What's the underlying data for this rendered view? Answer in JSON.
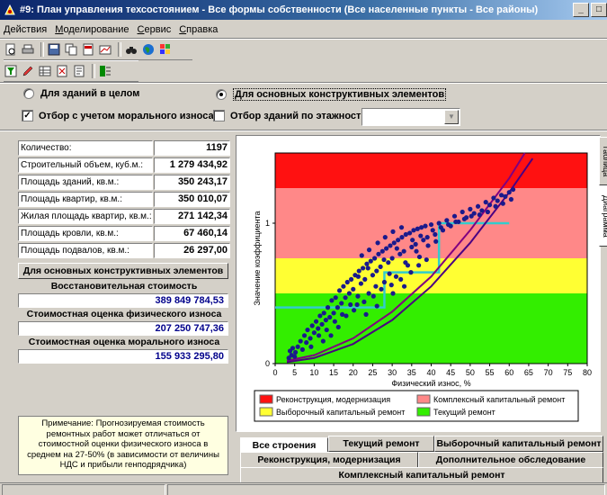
{
  "window": {
    "title": "#9: План управления техсостоянием - Все формы собственности (Все населенные пункты - Все районы)",
    "min_label": "_",
    "max_label": "□"
  },
  "menu": [
    "Действия",
    "Моделирование",
    "Сервис",
    "Справка"
  ],
  "toolbar_icons": {
    "row1": [
      "preview-icon",
      "print-icon",
      "save-icon",
      "copy-icon",
      "pdf-export-icon",
      "chart-export-icon",
      "binoculars-icon",
      "globe-icon",
      "palette-icon"
    ],
    "row2": [
      "filter-icon",
      "edit-icon",
      "table-icon",
      "calc-icon",
      "report-icon",
      "settings-icon"
    ]
  },
  "options": {
    "radio_whole": "Для зданий в целом",
    "radio_elements": "Для основных конструктивных элементов",
    "selected": "radio_elements",
    "chk_moral": "Отбор с учетом морального износа",
    "chk_moral_checked": true,
    "chk_floors": "Отбор зданий по этажности",
    "chk_floors_checked": false,
    "floors_value": ""
  },
  "stats": [
    {
      "label": "Количество:",
      "value": "1197"
    },
    {
      "label": "Строительный объем, куб.м.:",
      "value": "1 279 434,92"
    },
    {
      "label": "Площадь зданий, кв.м.:",
      "value": "350 243,17"
    },
    {
      "label": "Площадь квартир, кв.м.:",
      "value": "350 010,07"
    },
    {
      "label": "Жилая площадь квартир, кв.м.:",
      "value": "271 142,34"
    },
    {
      "label": "Площадь кровли, кв.м.:",
      "value": "67 460,14"
    },
    {
      "label": "Площадь подвалов, кв.м.:",
      "value": "26 297,00"
    }
  ],
  "section_button": "Для основных конструктивных элементов",
  "costs": [
    {
      "label": "Восстановительная стоимость",
      "value": "389 849 784,53"
    },
    {
      "label": "Стоимостная оценка физического износа",
      "value": "207 250 747,36"
    },
    {
      "label": "Стоимостная оценка морального износа",
      "value": "155 933 295,80"
    }
  ],
  "note": "Примечание: Прогнозируемая стоимость ремонтных работ может отличаться от стоимостной оценки физического износа в среднем на 27-50% (в зависимости от величины НДС и прибыли генподрядчика)",
  "side_tabs": [
    "Таблица",
    "Диаграмма"
  ],
  "bottom_tabs": {
    "row1": [
      "Все строения",
      "Текущий ремонт",
      "Выборочный капитальный ремонт"
    ],
    "row2": [
      "Реконструкция, модернизация",
      "Дополнительное обследование"
    ],
    "row3": [
      "Комплексный капитальный ремонт"
    ],
    "selected": "Все строения"
  },
  "chart_data": {
    "type": "scatter",
    "xlabel": "Физический износ, %",
    "ylabel": "Значение коэффициента",
    "xlim": [
      0,
      80
    ],
    "xticks": [
      0,
      5,
      10,
      15,
      20,
      25,
      30,
      35,
      40,
      45,
      50,
      55,
      60,
      65,
      70,
      75,
      80
    ],
    "ylim": [
      0,
      1.5
    ],
    "yticks": [
      {
        "v": 0,
        "label": "0"
      },
      {
        "v": 1,
        "label": "1"
      }
    ],
    "zones": [
      {
        "name": "Текущий ремонт",
        "from": 0,
        "to": 0.5,
        "color": "#33ee00"
      },
      {
        "name": "Выборочный капитальный ремонт",
        "from": 0.5,
        "to": 0.75,
        "color": "#ffff33"
      },
      {
        "name": "Комплексный капитальный ремонт",
        "from": 0.75,
        "to": 1.25,
        "color": "#ff8888"
      },
      {
        "name": "Реконструкция, модернизация",
        "from": 1.25,
        "to": 1.5,
        "color": "#ff1111"
      }
    ],
    "legend": [
      {
        "name": "Реконструкция, модернизация",
        "color": "#ff1111"
      },
      {
        "name": "Комплексный капитальный ремонт",
        "color": "#ff8888"
      },
      {
        "name": "Выборочный капитальный ремонт",
        "color": "#ffff33"
      },
      {
        "name": "Текущий ремонт",
        "color": "#33ee00"
      }
    ],
    "threshold_line": {
      "color": "#33cccc",
      "points": [
        [
          0,
          0.4
        ],
        [
          28,
          0.4
        ],
        [
          28,
          0.65
        ],
        [
          42,
          0.65
        ],
        [
          42,
          1.0
        ],
        [
          60,
          1.0
        ]
      ]
    },
    "curves": [
      {
        "color": "#800080",
        "points": [
          [
            3,
            0.02
          ],
          [
            10,
            0.06
          ],
          [
            20,
            0.18
          ],
          [
            30,
            0.37
          ],
          [
            40,
            0.62
          ],
          [
            50,
            0.95
          ],
          [
            60,
            1.32
          ],
          [
            64,
            1.5
          ]
        ]
      },
      {
        "color": "#4b0082",
        "points": [
          [
            3,
            0.01
          ],
          [
            10,
            0.04
          ],
          [
            20,
            0.14
          ],
          [
            30,
            0.31
          ],
          [
            40,
            0.55
          ],
          [
            50,
            0.86
          ],
          [
            60,
            1.22
          ],
          [
            66,
            1.46
          ]
        ]
      }
    ],
    "points": [
      [
        3.5,
        0.04
      ],
      [
        3.8,
        0.09
      ],
      [
        4.2,
        0.06
      ],
      [
        4.5,
        0.11
      ],
      [
        5.0,
        0.05
      ],
      [
        5.2,
        0.08
      ],
      [
        5.8,
        0.12
      ],
      [
        6.5,
        0.16
      ],
      [
        7.0,
        0.1
      ],
      [
        7.5,
        0.2
      ],
      [
        8.0,
        0.15
      ],
      [
        8.3,
        0.24
      ],
      [
        9.0,
        0.18
      ],
      [
        9.5,
        0.27
      ],
      [
        10.0,
        0.22
      ],
      [
        10.5,
        0.3
      ],
      [
        11.0,
        0.25
      ],
      [
        11.5,
        0.34
      ],
      [
        12.0,
        0.28
      ],
      [
        12.5,
        0.36
      ],
      [
        13.0,
        0.31
      ],
      [
        13.5,
        0.4
      ],
      [
        14.0,
        0.33
      ],
      [
        14.5,
        0.45
      ],
      [
        15.0,
        0.36
      ],
      [
        15.5,
        0.47
      ],
      [
        16.0,
        0.4
      ],
      [
        16.5,
        0.52
      ],
      [
        17.0,
        0.43
      ],
      [
        17.5,
        0.55
      ],
      [
        18.0,
        0.47
      ],
      [
        18.5,
        0.58
      ],
      [
        19.0,
        0.5
      ],
      [
        19.5,
        0.6
      ],
      [
        20.0,
        0.53
      ],
      [
        20.5,
        0.63
      ],
      [
        21.0,
        0.42
      ],
      [
        21.5,
        0.66
      ],
      [
        22.0,
        0.57
      ],
      [
        22.5,
        0.68
      ],
      [
        23.0,
        0.6
      ],
      [
        23.5,
        0.71
      ],
      [
        24.0,
        0.5
      ],
      [
        24.5,
        0.73
      ],
      [
        25.0,
        0.63
      ],
      [
        25.5,
        0.75
      ],
      [
        26.0,
        0.66
      ],
      [
        26.5,
        0.78
      ],
      [
        27.0,
        0.69
      ],
      [
        27.5,
        0.8
      ],
      [
        28.0,
        0.58
      ],
      [
        28.5,
        0.82
      ],
      [
        29.0,
        0.72
      ],
      [
        29.5,
        0.84
      ],
      [
        30.0,
        0.75
      ],
      [
        30.5,
        0.86
      ],
      [
        31.0,
        0.62
      ],
      [
        31.5,
        0.88
      ],
      [
        32.0,
        0.78
      ],
      [
        32.5,
        0.9
      ],
      [
        33.0,
        0.8
      ],
      [
        33.5,
        0.92
      ],
      [
        34.0,
        0.7
      ],
      [
        34.5,
        0.93
      ],
      [
        35.0,
        0.83
      ],
      [
        35.5,
        0.95
      ],
      [
        36.0,
        0.85
      ],
      [
        36.5,
        0.96
      ],
      [
        37.0,
        0.76
      ],
      [
        37.5,
        0.97
      ],
      [
        38.0,
        0.88
      ],
      [
        38.5,
        0.98
      ],
      [
        39.0,
        0.9
      ],
      [
        40.0,
        0.99
      ],
      [
        41.0,
        0.92
      ],
      [
        42.0,
        1.0
      ],
      [
        43.0,
        0.95
      ],
      [
        44.0,
        1.02
      ],
      [
        45.0,
        0.98
      ],
      [
        46.0,
        1.05
      ],
      [
        47.0,
        1.01
      ],
      [
        48.0,
        1.08
      ],
      [
        49.0,
        1.04
      ],
      [
        50.0,
        1.1
      ],
      [
        51.0,
        1.07
      ],
      [
        52.0,
        1.12
      ],
      [
        53.0,
        1.09
      ],
      [
        54.0,
        1.15
      ],
      [
        55.0,
        1.13
      ],
      [
        56.0,
        1.18
      ],
      [
        57.0,
        1.16
      ],
      [
        58.0,
        1.2
      ],
      [
        59.0,
        1.19
      ],
      [
        60.0,
        1.22
      ],
      [
        61.0,
        1.24
      ],
      [
        18.2,
        0.34
      ],
      [
        20.2,
        0.38
      ],
      [
        22.8,
        0.44
      ],
      [
        25.2,
        0.48
      ],
      [
        27.2,
        0.53
      ],
      [
        29.8,
        0.56
      ],
      [
        32.2,
        0.6
      ],
      [
        34.8,
        0.65
      ],
      [
        36.8,
        0.7
      ],
      [
        38.8,
        0.74
      ],
      [
        14.3,
        0.2
      ],
      [
        16.2,
        0.26
      ],
      [
        23.3,
        0.35
      ],
      [
        26.1,
        0.41
      ],
      [
        30.2,
        0.5
      ],
      [
        33.1,
        0.55
      ],
      [
        22.2,
        0.77
      ],
      [
        24.1,
        0.81
      ],
      [
        26.3,
        0.86
      ],
      [
        28.2,
        0.9
      ],
      [
        30.2,
        0.94
      ],
      [
        32.4,
        0.97
      ],
      [
        21.3,
        0.62
      ],
      [
        23.8,
        0.68
      ],
      [
        27.9,
        0.74
      ],
      [
        31.2,
        0.82
      ],
      [
        35.2,
        0.88
      ],
      [
        37.3,
        0.91
      ],
      [
        40.4,
        0.95
      ],
      [
        42.5,
        0.97
      ],
      [
        44.4,
        0.99
      ],
      [
        46.3,
        1.01
      ],
      [
        48.5,
        1.03
      ],
      [
        50.3,
        1.05
      ],
      [
        52.4,
        1.06
      ],
      [
        54.5,
        1.08
      ],
      [
        56.5,
        1.12
      ],
      [
        58.4,
        1.14
      ],
      [
        60.5,
        1.17
      ],
      [
        9.2,
        0.12
      ],
      [
        12.3,
        0.16
      ],
      [
        11.2,
        0.2
      ],
      [
        13.2,
        0.24
      ],
      [
        15.3,
        0.3
      ],
      [
        17.2,
        0.35
      ],
      [
        19.3,
        0.42
      ],
      [
        21.2,
        0.48
      ],
      [
        25.8,
        0.55
      ],
      [
        29.3,
        0.64
      ],
      [
        33.4,
        0.72
      ],
      [
        36.2,
        0.8
      ],
      [
        39.2,
        0.84
      ],
      [
        41.2,
        0.87
      ]
    ]
  }
}
